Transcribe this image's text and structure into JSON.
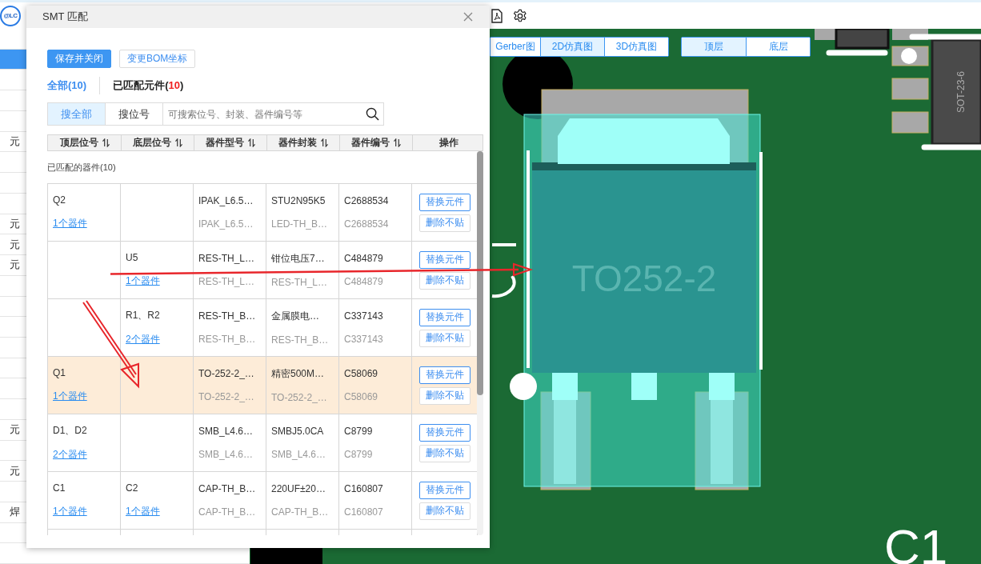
{
  "toolbar": {
    "logo": "@LC"
  },
  "left_panel": {
    "labels": [
      "元",
      "元",
      "元",
      "元",
      "元",
      "元",
      "焊"
    ]
  },
  "view_tabs": [
    {
      "label": "Gerber图",
      "selected": false
    },
    {
      "label": "2D仿真图",
      "selected": true
    },
    {
      "label": "3D仿真图",
      "selected": false
    }
  ],
  "layer_tabs": [
    {
      "label": "顶层",
      "selected": true
    },
    {
      "label": "底层",
      "selected": false
    }
  ],
  "pcb": {
    "component_label": "TO252-2",
    "chip_label": "SOT-23-6",
    "designator": "C1"
  },
  "dialog": {
    "title": "SMT 匹配",
    "buttons": [
      {
        "label": "保存并关闭",
        "kind": "primary"
      },
      {
        "label": "变更BOM坐标",
        "kind": "default"
      }
    ],
    "filters": [
      {
        "label": "全部(",
        "count": "10",
        "close": ")",
        "selected": true
      },
      {
        "label": "已匹配元件(",
        "count": "10",
        "close": ")",
        "selected": false
      }
    ],
    "search_modes": [
      {
        "label": "搜全部",
        "selected": true
      },
      {
        "label": "搜位号",
        "selected": false
      }
    ],
    "search": {
      "placeholder": "可搜索位号、封装、器件编号等"
    },
    "columns": [
      {
        "label": "顶层位号",
        "sortable": true
      },
      {
        "label": "底层位号",
        "sortable": true
      },
      {
        "label": "器件型号",
        "sortable": true
      },
      {
        "label": "器件封装",
        "sortable": true
      },
      {
        "label": "器件编号",
        "sortable": true
      },
      {
        "label": "操作",
        "sortable": false
      }
    ],
    "group_label": "已匹配的器件(10)",
    "rows": [
      {
        "selected": false,
        "top_ref": "Q2",
        "top_count": "1个器件",
        "model": [
          "IPAK_L6.5…",
          "IPAK_L6.5…"
        ],
        "package": [
          "STU2N95K5",
          "LED-TH_B…"
        ],
        "code": [
          "C2688534",
          "C2688534"
        ],
        "actions": [
          "替换元件",
          "删除不贴"
        ]
      },
      {
        "selected": false,
        "bottom_ref": "U5",
        "bottom_count": "1个器件",
        "model": [
          "RES-TH_L…",
          "RES-TH_L…"
        ],
        "package": [
          "钳位电压7…",
          "RES-TH_L…"
        ],
        "code": [
          "C484879",
          "C484879"
        ],
        "actions": [
          "替换元件",
          "删除不贴"
        ]
      },
      {
        "selected": false,
        "bottom_ref": "R1、R2",
        "bottom_count": "2个器件",
        "model": [
          "RES-TH_B…",
          "RES-TH_B…"
        ],
        "package": [
          "金属膜电…",
          "RES-TH_B…"
        ],
        "code": [
          "C337143",
          "C337143"
        ],
        "actions": [
          "替换元件",
          "删除不贴"
        ]
      },
      {
        "selected": true,
        "top_ref": "Q1",
        "top_count": "1个器件",
        "model": [
          "TO-252-2_…",
          "TO-252-2_…"
        ],
        "package": [
          "精密500M…",
          "TO-252-2_…"
        ],
        "code": [
          "C58069",
          "C58069"
        ],
        "actions": [
          "替换元件",
          "删除不贴"
        ]
      },
      {
        "selected": false,
        "top_ref": "D1、D2",
        "top_count": "2个器件",
        "model": [
          "SMB_L4.6…",
          "SMB_L4.6…"
        ],
        "package": [
          "SMBJ5.0CA",
          "SMB_L4.6…"
        ],
        "code": [
          "C8799",
          "C8799"
        ],
        "actions": [
          "替换元件",
          "删除不贴"
        ]
      },
      {
        "selected": false,
        "top_ref": "C1",
        "top_count": "1个器件",
        "bottom_ref": "C2",
        "bottom_count": "1个器件",
        "model": [
          "CAP-TH_B…",
          "CAP-TH_B…"
        ],
        "package": [
          "220UF±20…",
          "CAP-TH_B…"
        ],
        "code": [
          "C160807",
          "C160807"
        ],
        "actions": [
          "替换元件",
          "删除不贴"
        ]
      }
    ]
  }
}
